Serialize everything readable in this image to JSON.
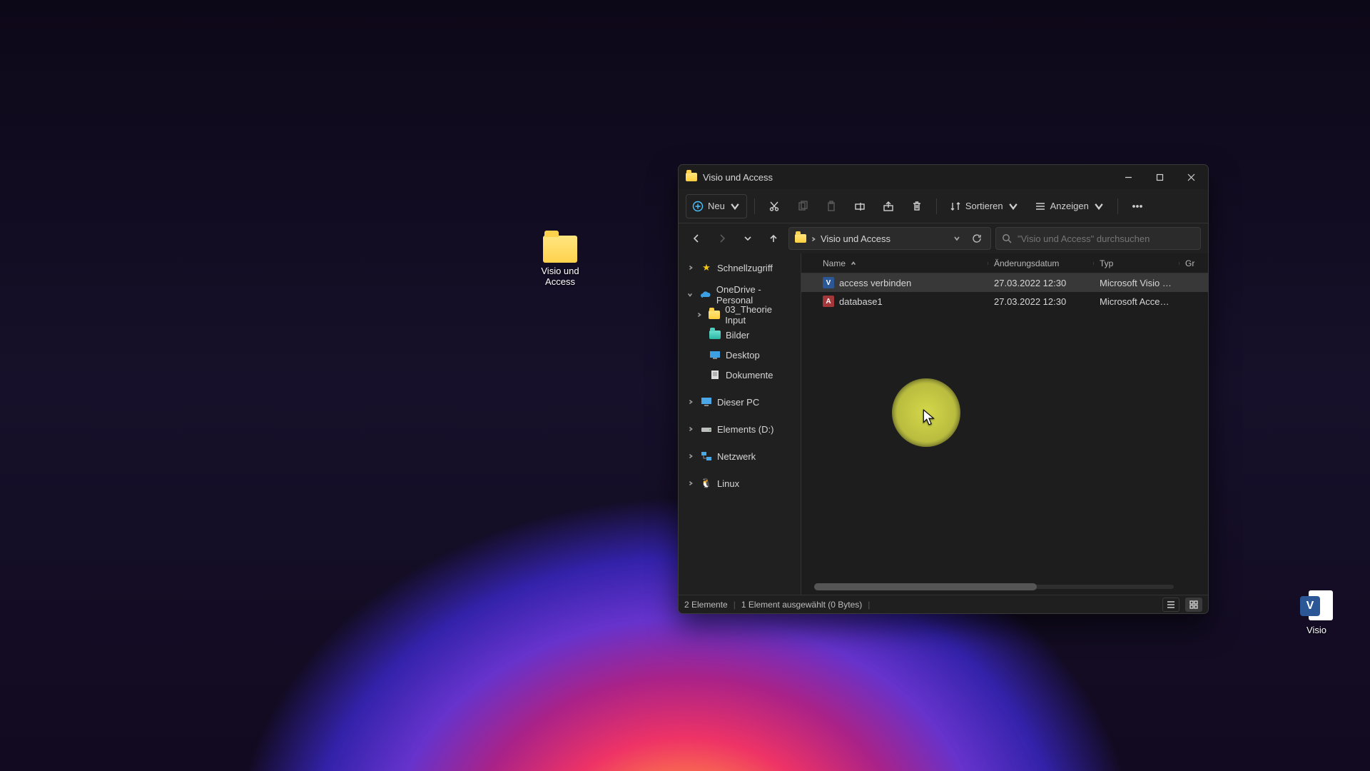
{
  "desktop": {
    "folder_icon_label": "Visio und Access",
    "visio_icon_label": "Visio",
    "visio_badge": "V"
  },
  "window": {
    "title": "Visio und Access"
  },
  "toolbar": {
    "new_label": "Neu",
    "sort_label": "Sortieren",
    "view_label": "Anzeigen"
  },
  "address": {
    "crumb": "Visio und Access"
  },
  "search": {
    "placeholder": "\"Visio und Access\" durchsuchen"
  },
  "navpane": {
    "quick_access": "Schnellzugriff",
    "onedrive": "OneDrive - Personal",
    "items": [
      "03_Theorie Input",
      "Bilder",
      "Desktop",
      "Dokumente"
    ],
    "this_pc": "Dieser PC",
    "drive": "Elements (D:)",
    "network": "Netzwerk",
    "linux": "Linux"
  },
  "columns": {
    "name": "Name",
    "date": "Änderungsdatum",
    "type": "Typ",
    "size": "Gr"
  },
  "files": [
    {
      "name": "access verbinden",
      "date": "27.03.2022 12:30",
      "type": "Microsoft Visio Dr...",
      "kind": "visio",
      "badge": "V",
      "selected": true
    },
    {
      "name": "database1",
      "date": "27.03.2022 12:30",
      "type": "Microsoft Access ...",
      "kind": "access",
      "badge": "A",
      "selected": false
    }
  ],
  "status": {
    "count": "2 Elemente",
    "selection": "1 Element ausgewählt (0 Bytes)"
  }
}
